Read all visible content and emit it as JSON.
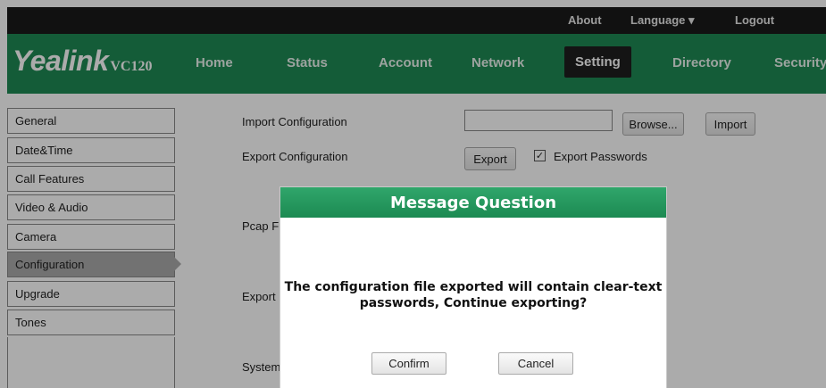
{
  "topbar": {
    "about": "About",
    "language": "Language ▾",
    "logout": "Logout"
  },
  "brand": {
    "name": "Yealink",
    "model": "VC120"
  },
  "nav": [
    {
      "label": "Home"
    },
    {
      "label": "Status"
    },
    {
      "label": "Account"
    },
    {
      "label": "Network"
    },
    {
      "label": "Setting",
      "active": true
    },
    {
      "label": "Directory"
    },
    {
      "label": "Security"
    }
  ],
  "sidebar": {
    "items": [
      {
        "label": "General"
      },
      {
        "label": "Date&Time"
      },
      {
        "label": "Call Features"
      },
      {
        "label": "Video & Audio"
      },
      {
        "label": "Camera"
      },
      {
        "label": "Configuration",
        "active": true
      },
      {
        "label": "Upgrade"
      },
      {
        "label": "Tones"
      }
    ]
  },
  "content": {
    "import_label": "Import Configuration",
    "import_value": "",
    "browse_label": "Browse...",
    "import_button": "Import",
    "export_label": "Export Configuration",
    "export_button": "Export",
    "export_passwords_label": "Export Passwords",
    "export_passwords_checked": true,
    "pcap_label_partial": "Pcap F",
    "export_label_partial": "Export",
    "system_label_partial": "System"
  },
  "dialog": {
    "title": "Message Question",
    "message_line1": "The configuration file exported will contain clear-text",
    "message_line2": "passwords, Continue exporting?",
    "confirm_label": "Confirm",
    "cancel_label": "Cancel"
  },
  "colors": {
    "brand_green": "#1f8a54",
    "topbar": "#1a1a1a",
    "active_tab": "#1f1f1f",
    "sidebar_active": "#aaaaaa"
  }
}
